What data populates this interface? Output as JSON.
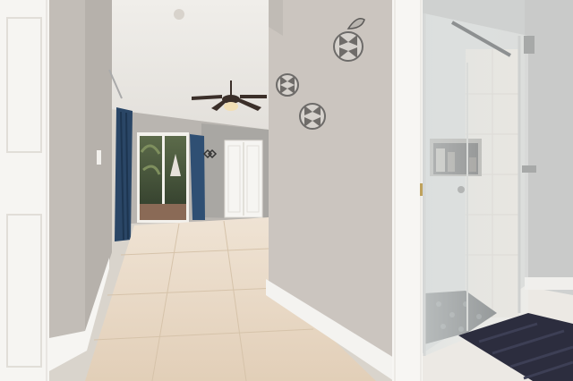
{
  "scene": {
    "kind": "interior-photo",
    "elements": [
      "hallway",
      "ceiling-fan",
      "sliding-glass-door",
      "blue-curtains",
      "closet-door",
      "wall-flower-decor",
      "glass-shower-enclosure",
      "bath-mat",
      "tile-floor"
    ]
  },
  "colors": {
    "wall": "#c9c3bd",
    "ceiling": "#ece9e4",
    "floor": "#e9d9c6",
    "trim": "#f6f5f2",
    "curtain": "#2d4a6b",
    "shower_tile": "#e4dfd8",
    "mat": "#2c2d3e",
    "fan": "#3b2f29"
  }
}
